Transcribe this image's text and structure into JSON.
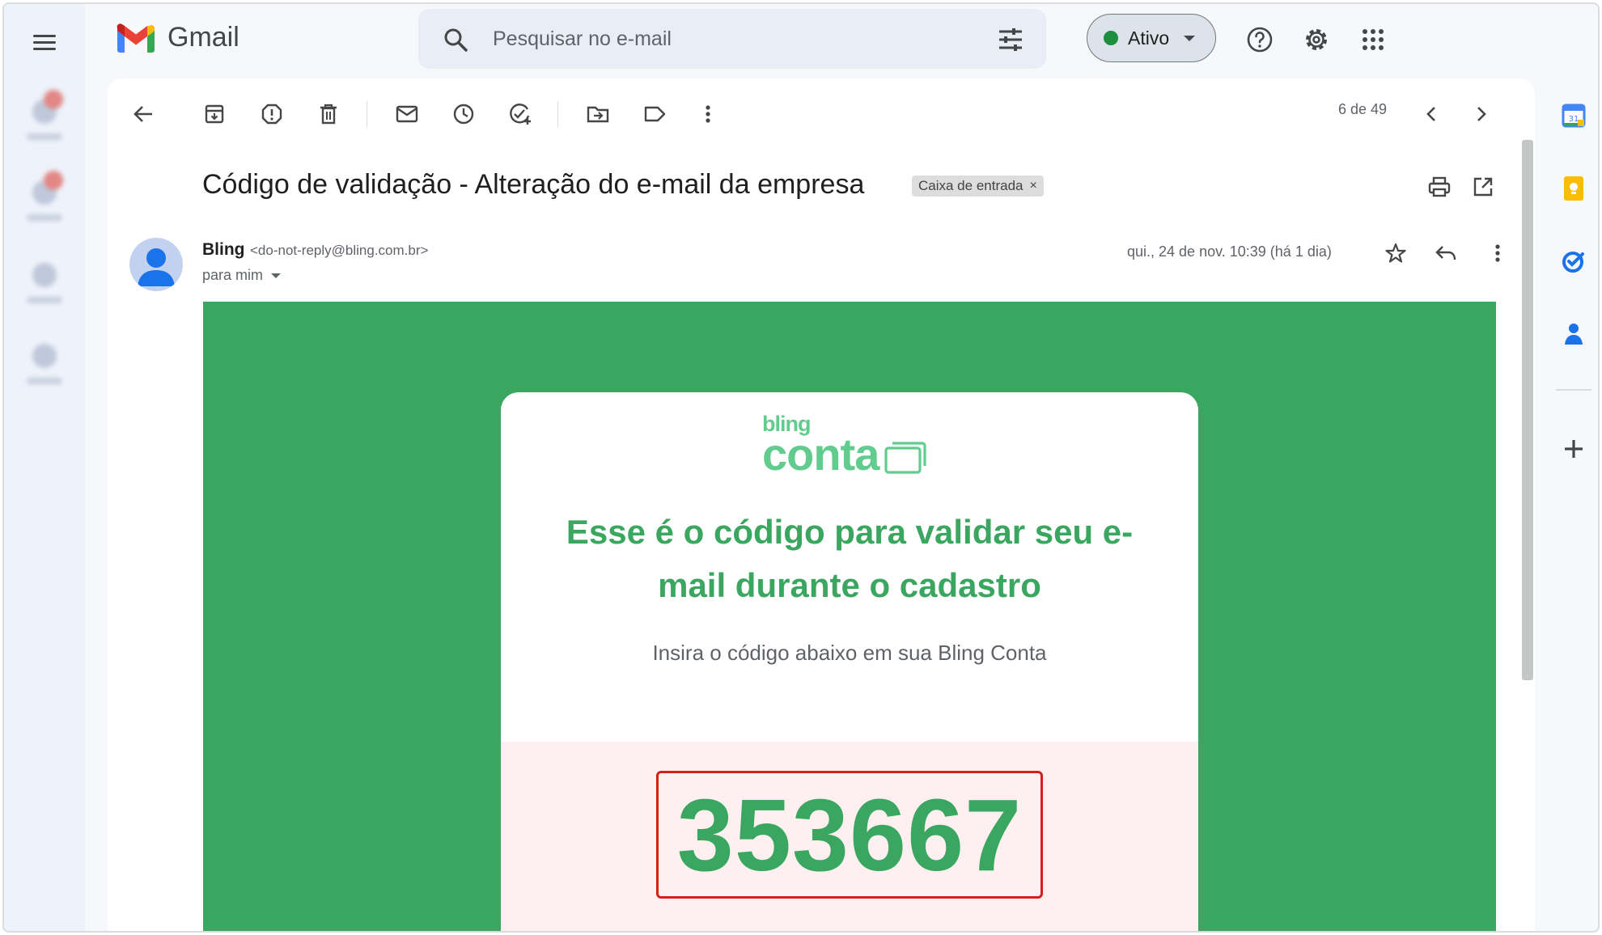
{
  "app": {
    "logo_text": "Gmail"
  },
  "search": {
    "placeholder": "Pesquisar no e-mail"
  },
  "status": {
    "label": "Ativo",
    "color": "#1e8e3e"
  },
  "header_icons": [
    "help-icon",
    "settings-icon",
    "apps-grid-icon"
  ],
  "toolbar": {
    "icons": [
      "back-arrow-icon",
      "archive-icon",
      "report-spam-icon",
      "delete-icon",
      "mark-unread-icon",
      "snooze-icon",
      "add-task-icon",
      "move-to-icon",
      "label-icon",
      "more-vert-icon"
    ],
    "pager": "6 de 49"
  },
  "message": {
    "subject": "Código de validação - Alteração do e-mail da empresa",
    "label_chip": "Caixa de entrada",
    "label_close": "×",
    "sender_name": "Bling",
    "sender_email": "<do-not-reply@bling.com.br>",
    "to": "para mim",
    "date": "qui., 24 de nov. 10:39 (há 1 dia)"
  },
  "email_content": {
    "brand_small": "bling",
    "brand_big": "conta",
    "headline": "Esse é o código para validar seu e-mail durante o cadastro",
    "instructions": "Insira o código abaixo em sua Bling Conta",
    "code": "353667",
    "background_color": "#3aa660",
    "code_border_color": "#d91e18"
  },
  "side_panel": {
    "icons": [
      "calendar-icon",
      "keep-icon",
      "tasks-icon",
      "contacts-icon",
      "add-icon"
    ]
  }
}
